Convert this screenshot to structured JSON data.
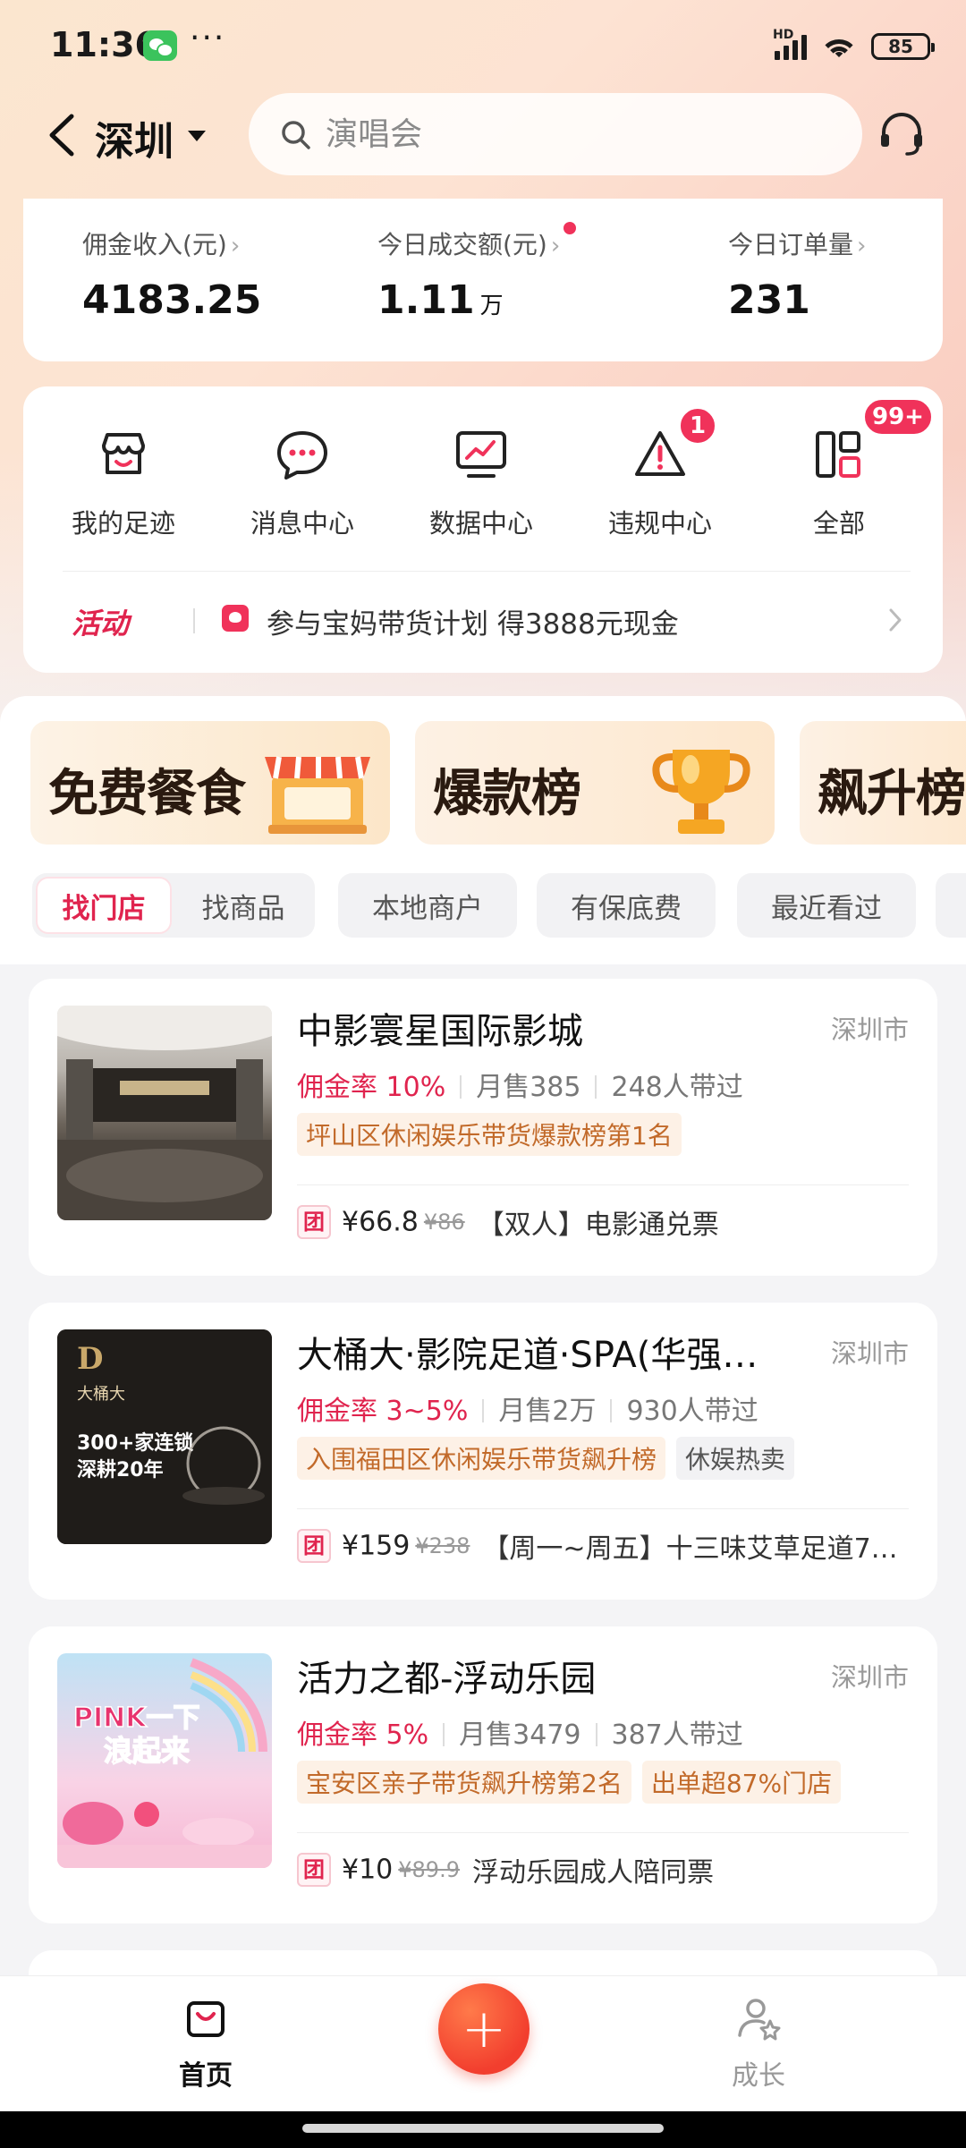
{
  "status_bar": {
    "time": "11:36",
    "dots": "···",
    "network": "HD",
    "battery": "85"
  },
  "header": {
    "city": "深圳",
    "search_placeholder": "演唱会"
  },
  "stats": [
    {
      "label": "佣金收入(元)",
      "value": "4183.25",
      "unit": ""
    },
    {
      "label": "今日成交额(元)",
      "value": "1.11",
      "unit": "万"
    },
    {
      "label": "今日订单量",
      "value": "231",
      "unit": ""
    }
  ],
  "tools": [
    {
      "label": "我的足迹",
      "icon": "shop-face-icon",
      "badge": ""
    },
    {
      "label": "消息中心",
      "icon": "chat-bubble-icon",
      "badge": ""
    },
    {
      "label": "数据中心",
      "icon": "chart-monitor-icon",
      "badge": ""
    },
    {
      "label": "违规中心",
      "icon": "warning-triangle-icon",
      "badge": "1"
    },
    {
      "label": "全部",
      "icon": "grid-icon",
      "badge": "99+"
    }
  ],
  "promo": {
    "tag": "活动",
    "text": "参与宝妈带货计划  得3888元现金"
  },
  "rank_banners": [
    {
      "title": "免费餐食"
    },
    {
      "title": "爆款榜"
    },
    {
      "title": "飙升榜"
    }
  ],
  "filters": [
    {
      "label": "找门店",
      "active": true
    },
    {
      "label": "找商品",
      "active": false
    },
    {
      "label": "本地商户",
      "active": false
    },
    {
      "label": "有保底费",
      "active": false
    },
    {
      "label": "最近看过",
      "active": false
    }
  ],
  "shops": [
    {
      "name": "中影寰星国际影城",
      "city": "深圳市",
      "rate": "佣金率 10%",
      "sales": "月售385",
      "promoters": "248人带过",
      "tags": [
        {
          "text": "坪山区休闲娱乐带货爆款榜第1名",
          "style": "orange"
        }
      ],
      "deal_badge": "团",
      "deal_price": "¥66.8",
      "deal_orig": "¥86",
      "deal_name": "【双人】电影通兑票"
    },
    {
      "name": "大桶大·影院足道·SPA(华强…",
      "city": "深圳市",
      "rate": "佣金率 3~5%",
      "sales": "月售2万",
      "promoters": "930人带过",
      "tags": [
        {
          "text": "入围福田区休闲娱乐带货飙升榜",
          "style": "orange"
        },
        {
          "text": "休娱热卖",
          "style": "gray"
        }
      ],
      "deal_badge": "团",
      "deal_price": "¥159",
      "deal_orig": "¥238",
      "deal_name": "【周一~周五】十三味艾草足道7…",
      "img_text_brand": "大桶大",
      "img_text_line1": "300+家连锁",
      "img_text_line2": "深耕20年"
    },
    {
      "name": "活力之都-浮动乐园",
      "city": "深圳市",
      "rate": "佣金率 5%",
      "sales": "月售3479",
      "promoters": "387人带过",
      "tags": [
        {
          "text": "宝安区亲子带货飙升榜第2名",
          "style": "orange"
        },
        {
          "text": "出单超87%门店",
          "style": "orange"
        }
      ],
      "deal_badge": "团",
      "deal_price": "¥10",
      "deal_orig": "¥89.9",
      "deal_name": "浮动乐园成人陪同票",
      "img_text_line1": "PINK一下",
      "img_text_line2": "浪起来"
    }
  ],
  "bottom_nav": [
    {
      "label": "首页",
      "icon": "shopping-bag-icon",
      "active": true
    },
    {
      "label": "",
      "icon": "plus-icon",
      "active": false
    },
    {
      "label": "成长",
      "icon": "user-star-icon",
      "active": false
    }
  ],
  "colors": {
    "accent": "#e0244e",
    "badge": "#f0325a",
    "fab": "#f23e2e",
    "tag_bg": "#fdf1e6",
    "tag_text": "#c26a2a"
  }
}
